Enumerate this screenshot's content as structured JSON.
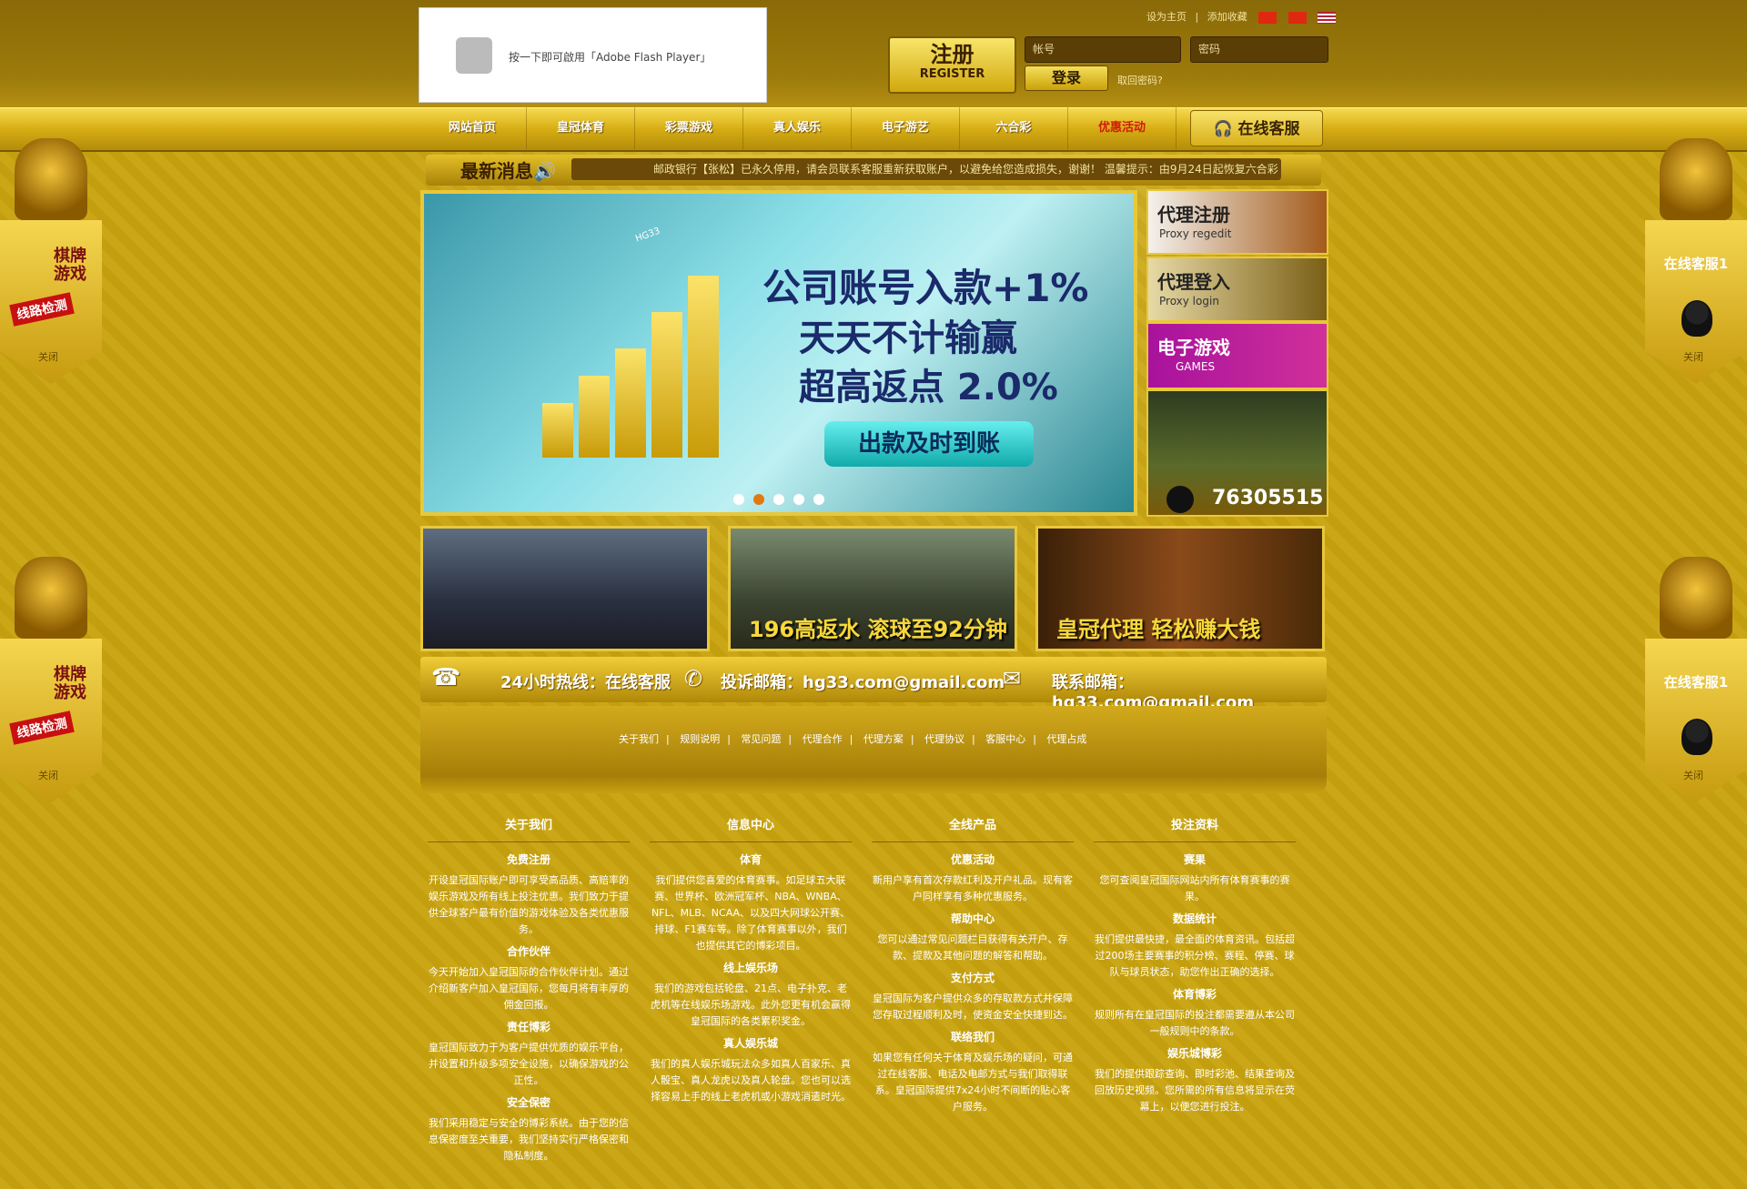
{
  "header": {
    "flash_text": "按一下即可啟用「Adobe Flash Player」",
    "links": [
      "设为主页",
      "添加收藏"
    ],
    "register_cn": "注册",
    "register_en": "REGISTER",
    "username_placeholder": "帐号",
    "password_placeholder": "密码",
    "login_label": "登录",
    "forgot_label": "取回密码?"
  },
  "nav": {
    "items": [
      "网站首页",
      "皇冠体育",
      "彩票游戏",
      "真人娱乐",
      "电子游艺",
      "六合彩",
      "优惠活动"
    ],
    "service_label": "在线客服"
  },
  "news": {
    "label": "最新消息",
    "ticker": "邮政银行【张松】已永久停用，请会员联系客服重新获取账户，以避免给您造成损失，谢谢！   温馨提示：由9月24日起恢复六合彩"
  },
  "banner": {
    "line1": "公司账号入款+1%",
    "line2": "天天不计输赢",
    "line3": "超高返点 2.0%",
    "button": "出款及时到账",
    "bar_label": "HG33",
    "active_dot": 1,
    "dot_count": 5
  },
  "tiles": [
    {
      "title": "代理注册",
      "subtitle": "Proxy regedit"
    },
    {
      "title": "代理登入",
      "subtitle": "Proxy login"
    },
    {
      "title": "电子游戏",
      "subtitle": "GAMES"
    },
    {
      "title": "",
      "subtitle": "76305515"
    }
  ],
  "promos": [
    {
      "caption": ""
    },
    {
      "caption": "196高返水 滚球至92分钟"
    },
    {
      "caption": "皇冠代理 轻松赚大钱"
    }
  ],
  "contact": {
    "hotline": "24小时热线：在线客服",
    "complaint": "投诉邮箱：hg33.com@gmail.com",
    "email": "联系邮箱：hg33.com@gmail.com"
  },
  "footer_links": [
    "关于我们",
    "规则说明",
    "常见问题",
    "代理合作",
    "代理方案",
    "代理协议",
    "客服中心",
    "代理占成"
  ],
  "columns": [
    {
      "title": "关于我们",
      "sections": [
        {
          "sub": "免费注册",
          "text": "开设皇冠国际账户即可享受高品质、高赔率的娱乐游戏及所有线上投注优惠。我们致力于提供全球客户最有价值的游戏体验及各类优惠服务。"
        },
        {
          "sub": "合作伙伴",
          "text": "今天开始加入皇冠国际的合作伙伴计划。通过介绍新客户加入皇冠国际，您每月将有丰厚的佣金回报。"
        },
        {
          "sub": "责任博彩",
          "text": "皇冠国际致力于为客户提供优质的娱乐平台，并设置和升级多项安全设施，以确保游戏的公正性。"
        },
        {
          "sub": "安全保密",
          "text": "我们采用稳定与安全的博彩系统。由于您的信息保密度至关重要，我们坚持实行严格保密和隐私制度。"
        }
      ]
    },
    {
      "title": "信息中心",
      "sections": [
        {
          "sub": "体育",
          "text": "我们提供您喜爱的体育赛事。如足球五大联赛、世界杯、欧洲冠军杯、NBA、WNBA、NFL、MLB、NCAA、以及四大网球公开赛、排球、F1赛车等。除了体育赛事以外，我们也提供其它的博彩项目。"
        },
        {
          "sub": "线上娱乐场",
          "text": "我们的游戏包括轮盘、21点、电子扑克、老虎机等在线娱乐场游戏。此外您更有机会赢得皇冠国际的各类累积奖金。"
        },
        {
          "sub": "真人娱乐城",
          "text": "我们的真人娱乐城玩法众多如真人百家乐、真人骰宝、真人龙虎以及真人轮盘。您也可以选择容易上手的线上老虎机或小游戏消遣时光。"
        }
      ]
    },
    {
      "title": "全线产品",
      "sections": [
        {
          "sub": "优惠活动",
          "text": "新用户享有首次存款红利及开户礼品。现有客户同样享有多种优惠服务。"
        },
        {
          "sub": "帮助中心",
          "text": "您可以通过常见问题栏目获得有关开户、存款、提款及其他问题的解答和帮助。"
        },
        {
          "sub": "支付方式",
          "text": "皇冠国际为客户提供众多的存取款方式并保障您存取过程顺利及时，使资金安全快捷到达。"
        },
        {
          "sub": "联络我们",
          "text": "如果您有任何关于体育及娱乐场的疑问，可通过在线客服、电话及电邮方式与我们取得联系。皇冠国际提供7x24小时不间断的贴心客户服务。"
        }
      ]
    },
    {
      "title": "投注资料",
      "sections": [
        {
          "sub": "赛果",
          "text": "您可查阅皇冠国际网站内所有体育赛事的赛果。"
        },
        {
          "sub": "数据统计",
          "text": "我们提供最快捷，最全面的体育资讯。包括超过200场主要赛事的积分榜、赛程、停赛、球队与球员状态，助您作出正确的选择。"
        },
        {
          "sub": "体育博彩",
          "text": "规则所有在皇冠国际的投注都需要遵从本公司一般规则中的条款。"
        },
        {
          "sub": "娱乐城博彩",
          "text": "我们的提供跟踪查询、即时彩池、结果查询及回放历史视频。您所需的所有信息将显示在荧幕上，以便您进行投注。"
        }
      ]
    }
  ],
  "side_left": {
    "line1": "棋牌游戏",
    "line2": "线路检测",
    "close": "关闭"
  },
  "side_right": {
    "line1": "在线客服1",
    "close": "关闭"
  },
  "colors": {
    "accent": "#c9a411",
    "news_bg": "#6b4908",
    "hot_nav": "#d21a0a"
  }
}
